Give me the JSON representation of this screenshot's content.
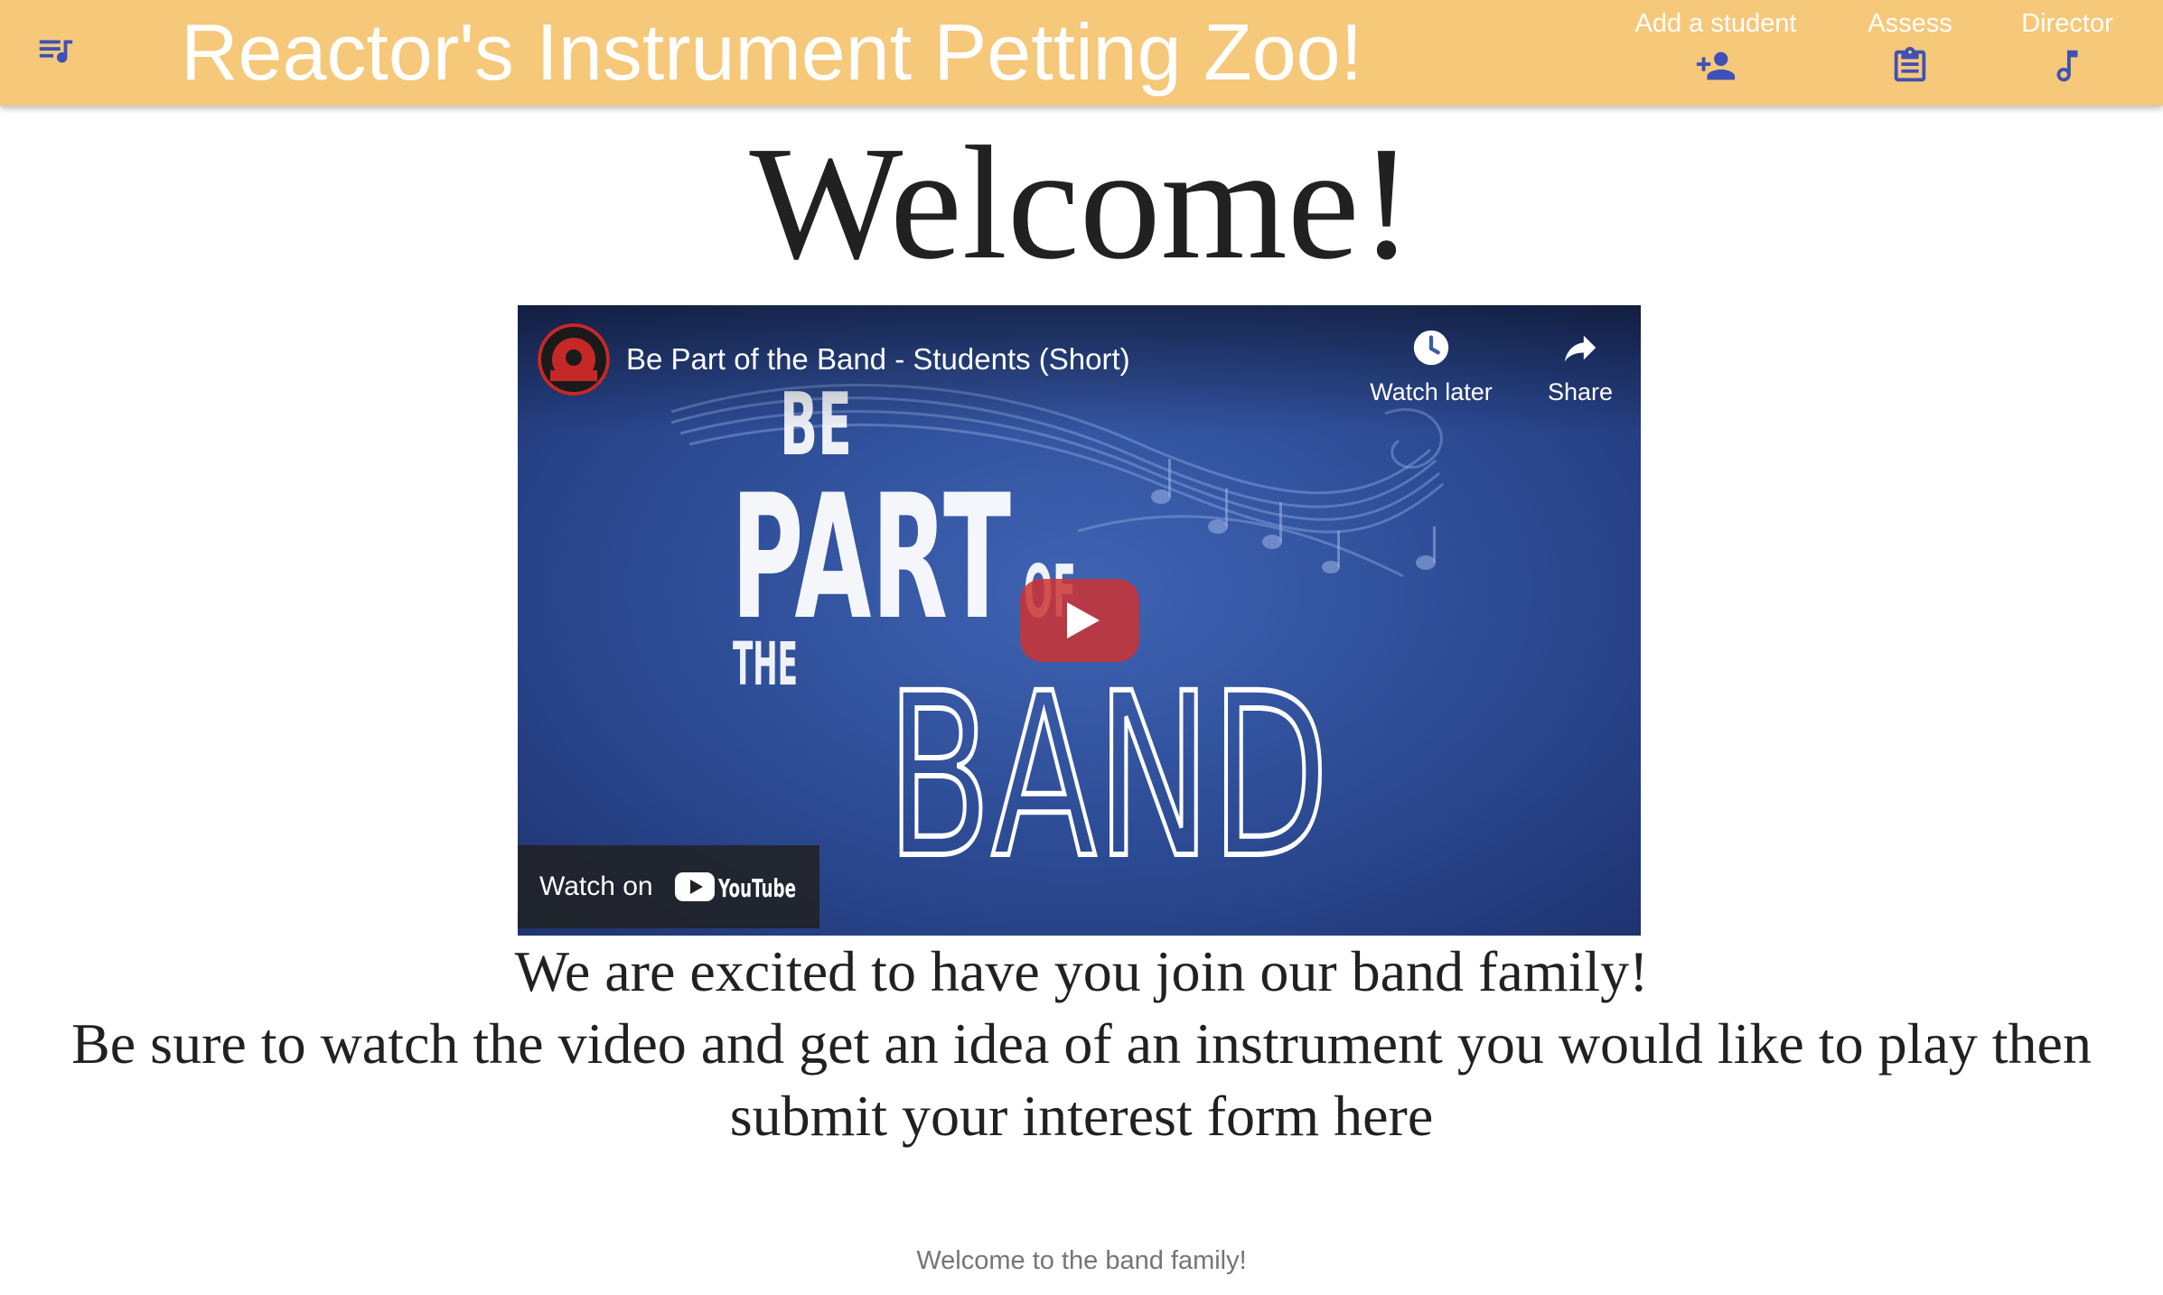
{
  "app_bar": {
    "menu_icon": "queue-music-icon",
    "title": "Reactor's Instrument Petting Zoo!",
    "nav": [
      {
        "label": "Add a student",
        "icon": "person-add-icon"
      },
      {
        "label": "Assess",
        "icon": "clipboard-icon"
      },
      {
        "label": "Director",
        "icon": "music-note-icon"
      }
    ],
    "background_color": "#f6c87a",
    "icon_color": "#3f51b5"
  },
  "main": {
    "heading": "Welcome!",
    "video": {
      "title": "Be Part of the Band - Students (Short)",
      "watch_later_label": "Watch later",
      "share_label": "Share",
      "watch_on_label": "Watch on",
      "youtube_logo": "YouTube",
      "thumbnail_text": {
        "be": "BE",
        "part": "PART",
        "of": "OF",
        "the": "THE",
        "band": "BAND"
      },
      "icons": {
        "watch_later": "clock-icon",
        "share": "share-arrow-icon",
        "play": "play-icon"
      }
    },
    "intro_line_1": "We are excited to have you join our band family!",
    "intro_line_2": "Be sure to watch the video and get an idea of an instrument you would like to play then submit your interest form here"
  },
  "footer": {
    "text": "Welcome to the band family!"
  }
}
